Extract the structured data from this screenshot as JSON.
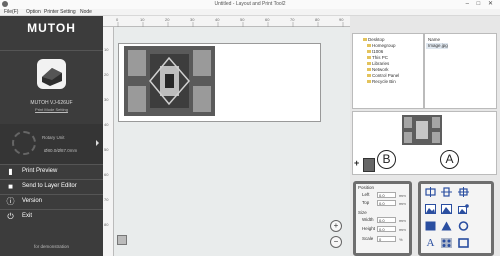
{
  "window": {
    "title": "Untitled - Layout and Print Tool2",
    "controls": "–  □  ✕"
  },
  "menu": [
    "File(F)",
    "Option",
    "Printer Setting",
    "Node"
  ],
  "sidebar": {
    "logo": "MUTOH",
    "printer_name": "MUTOH VJ-626UF",
    "printer_link": "Print Mode Setting",
    "rotary_label": "Rotary Unit",
    "rotary_value": "Ø80.0/Ø87.0mm",
    "buttons": [
      {
        "label": "Print Preview",
        "icon": "print-icon"
      },
      {
        "label": "Send to Layer Editor",
        "icon": "send-icon"
      },
      {
        "label": "Version",
        "icon": "info-icon"
      },
      {
        "label": "Exit",
        "icon": "power-icon"
      }
    ],
    "demo": "for demonstration"
  },
  "ruler": {
    "top_ticks": [
      "0",
      "10",
      "20",
      "30",
      "40",
      "50",
      "60",
      "70",
      "80",
      "90"
    ],
    "left_ticks": [
      "10",
      "20",
      "30",
      "40",
      "50",
      "60",
      "70",
      "80"
    ]
  },
  "explorer": {
    "tree": [
      "Desktop",
      "Homegroup",
      "t1006",
      "This PC",
      "Libraries",
      "Network",
      "Control Panel",
      "Recycle Bin"
    ],
    "file_header": "Name",
    "file_selected": "Image.jpg"
  },
  "callouts": {
    "a": "A",
    "b": "B"
  },
  "properties": {
    "position_label": "Position",
    "left_label": "Left",
    "left_value": "0.0",
    "top_label": "Top",
    "top_value": "0.0",
    "size_label": "Size",
    "width_label": "Width",
    "width_value": "0.0",
    "height_label": "Height",
    "height_value": "0.0",
    "scale_label": "Scale",
    "scale_value": "0",
    "unit": "mm",
    "scale_unit": "%"
  },
  "tools": [
    "align-horizontal-center-icon",
    "align-vertical-center-icon",
    "center-both-icon",
    "image-fit-icon",
    "image-mirror-icon",
    "image-extra-icon",
    "fill-rectangle-icon",
    "triangle-icon",
    "circle-icon",
    "text-icon",
    "pattern-icon",
    "frame-icon"
  ],
  "colors": {
    "sidebar_bg": "#3c3c3c",
    "tool_blue": "#2a4ea0",
    "box_border": "#6e6e6e"
  }
}
